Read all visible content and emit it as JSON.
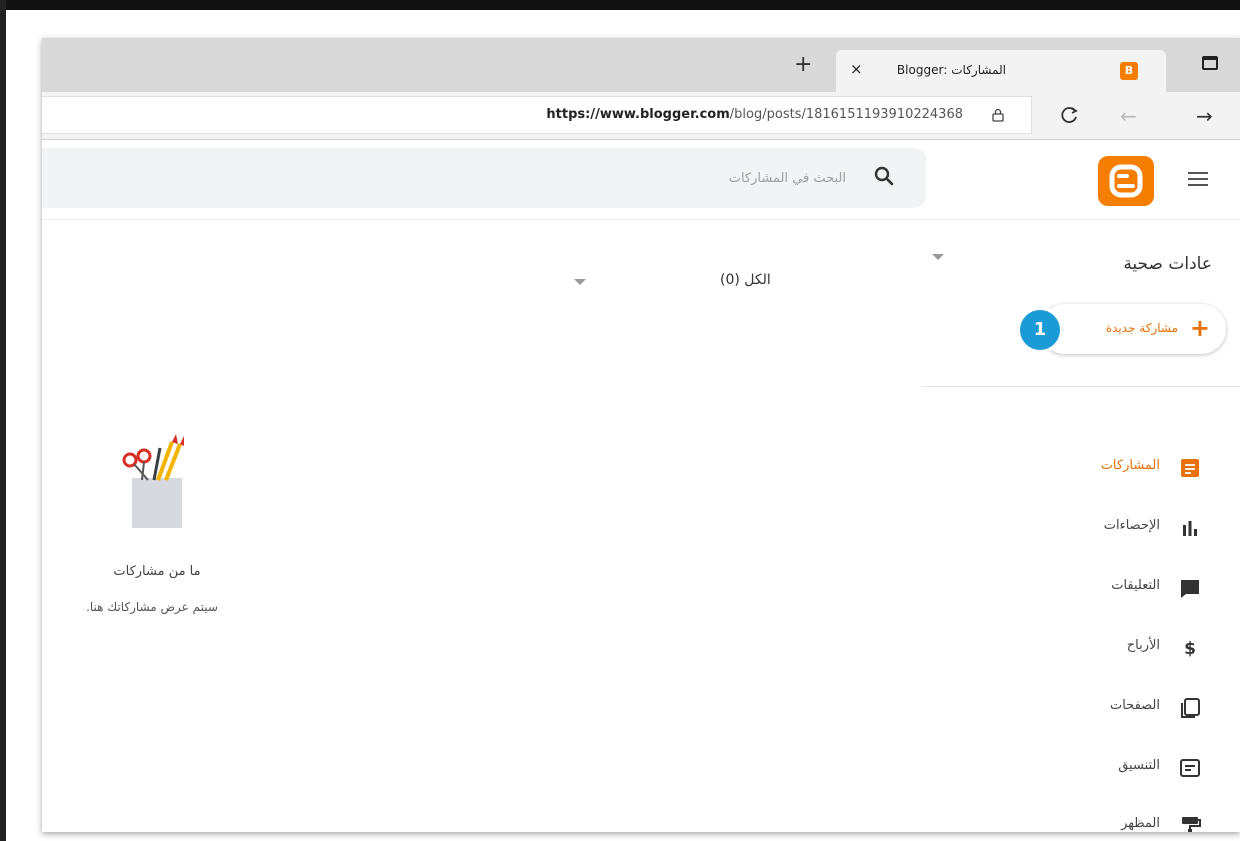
{
  "browser": {
    "tab_title": "المشاركات :Blogger",
    "tab_close": "×",
    "new_tab": "+",
    "url_host": "https://www.blogger.com",
    "url_path": "/blog/posts/1816151193910224368",
    "back": "←",
    "forward": "→",
    "reload": "C"
  },
  "header": {
    "search_placeholder": "البحث في المشاركات"
  },
  "sidebar": {
    "blog_name": "عادات صحية",
    "new_post_label": "مشاركة جديدة",
    "new_post_plus": "+",
    "step_badge": "1",
    "items": [
      {
        "label": "المشاركات",
        "icon": "posts-icon",
        "active": true
      },
      {
        "label": "الإحصاءات",
        "icon": "stats-icon",
        "active": false
      },
      {
        "label": "التعليقات",
        "icon": "comments-icon",
        "active": false
      },
      {
        "label": "الأرباح",
        "icon": "earnings-icon",
        "active": false
      },
      {
        "label": "الصفحات",
        "icon": "pages-icon",
        "active": false
      },
      {
        "label": "التنسيق",
        "icon": "layout-icon",
        "active": false
      },
      {
        "label": "المظهر",
        "icon": "theme-icon",
        "active": false
      }
    ]
  },
  "main": {
    "filter_label": "الكل (0)",
    "empty_title": "ما من مشاركات",
    "empty_subtitle": "سيتم عرض مشاركاتك هنا."
  },
  "colors": {
    "accent": "#e8710a",
    "blogger_orange": "#f57d00",
    "badge_blue": "#1a9bd7"
  }
}
